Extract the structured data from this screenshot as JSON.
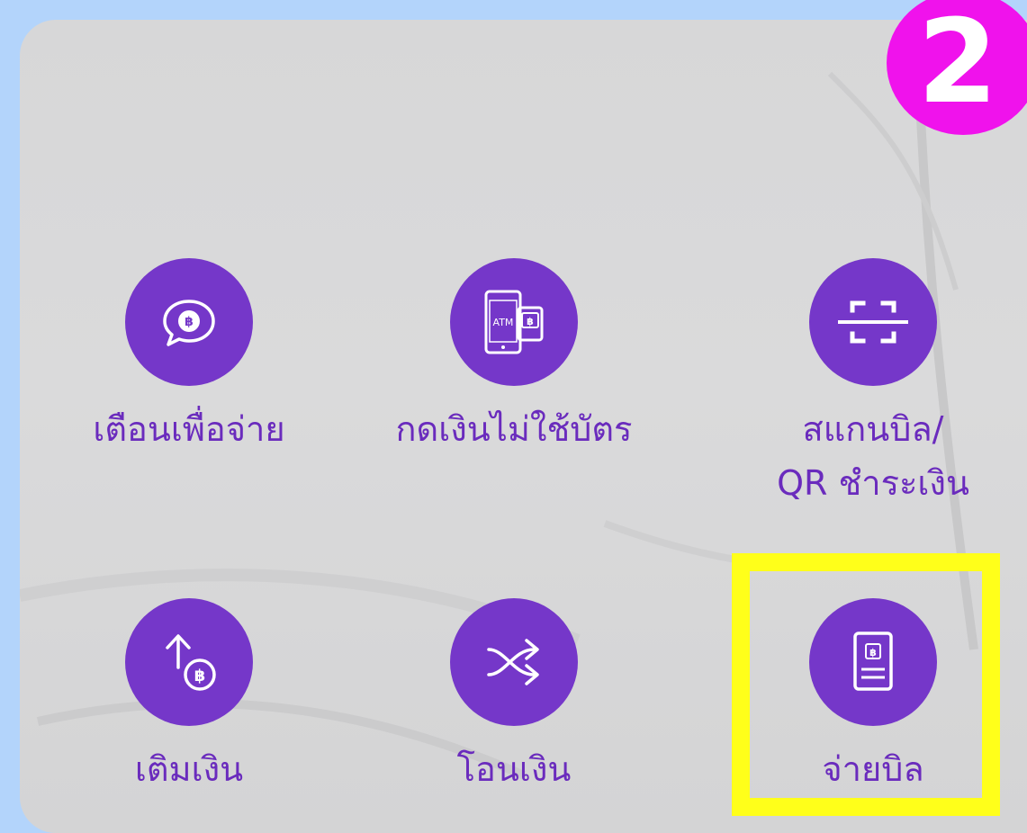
{
  "step_badge": {
    "text": "2",
    "color": "#f012ec"
  },
  "colors": {
    "background": "#b3d4fb",
    "panel": "#d8d8d9",
    "icon_circle": "#7537c9",
    "label": "#6a2bbd",
    "highlight": "#ffff1a"
  },
  "menu": {
    "items": [
      {
        "icon": "baht-chat-bubble-icon",
        "label": "เตือนเพื่อจ่าย"
      },
      {
        "icon": "atm-cardless-icon",
        "label": "กดเงินไม่ใช้บัตร",
        "icon_text": "ATM"
      },
      {
        "icon": "scan-frame-icon",
        "label_line1": "สแกนบิล/",
        "label_line2": "QR ชำระเงิน"
      },
      {
        "icon": "top-up-baht-icon",
        "label": "เติมเงิน"
      },
      {
        "icon": "transfer-shuffle-icon",
        "label": "โอนเงิน"
      },
      {
        "icon": "bill-receipt-icon",
        "label": "จ่ายบิล",
        "highlighted": true
      }
    ]
  }
}
